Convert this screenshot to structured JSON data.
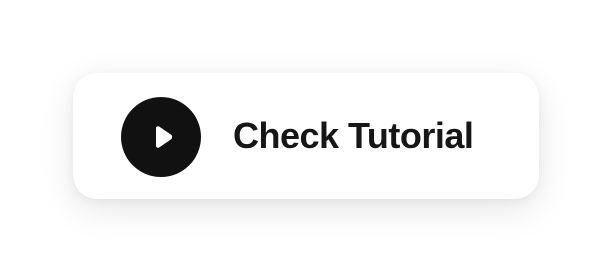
{
  "tutorial_button": {
    "label": "Check Tutorial",
    "icon": "play-icon",
    "colors": {
      "icon_background": "#111111",
      "icon_glyph": "#ffffff",
      "text": "#161616",
      "card_background": "#ffffff"
    }
  }
}
